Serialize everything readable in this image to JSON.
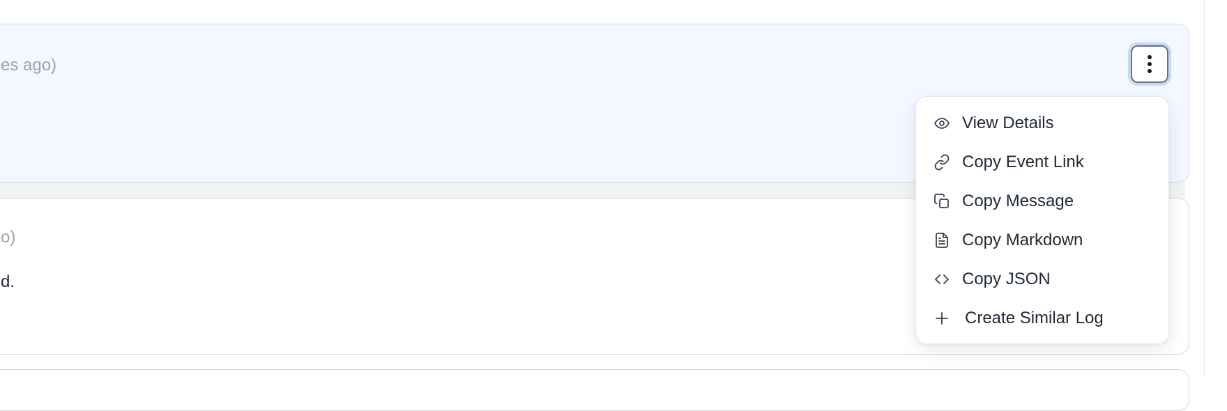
{
  "log_list": {
    "entries": [
      {
        "time_text": "es ago)",
        "message": ""
      },
      {
        "time_text": "o)",
        "message": "d."
      }
    ]
  },
  "menu": {
    "items": [
      {
        "label": "View Details",
        "icon": "eye-icon"
      },
      {
        "label": "Copy Event Link",
        "icon": "link-icon"
      },
      {
        "label": "Copy Message",
        "icon": "copy-icon"
      },
      {
        "label": "Copy Markdown",
        "icon": "file-text-icon"
      },
      {
        "label": "Copy JSON",
        "icon": "code-icon"
      },
      {
        "label": "Create Similar Log",
        "icon": "plus-icon"
      }
    ]
  },
  "colors": {
    "selected_row_bg": "#f3f7ff",
    "focus_ring": "#c7d9f5",
    "text_primary": "#1f2937",
    "text_muted": "#9ca3af"
  }
}
